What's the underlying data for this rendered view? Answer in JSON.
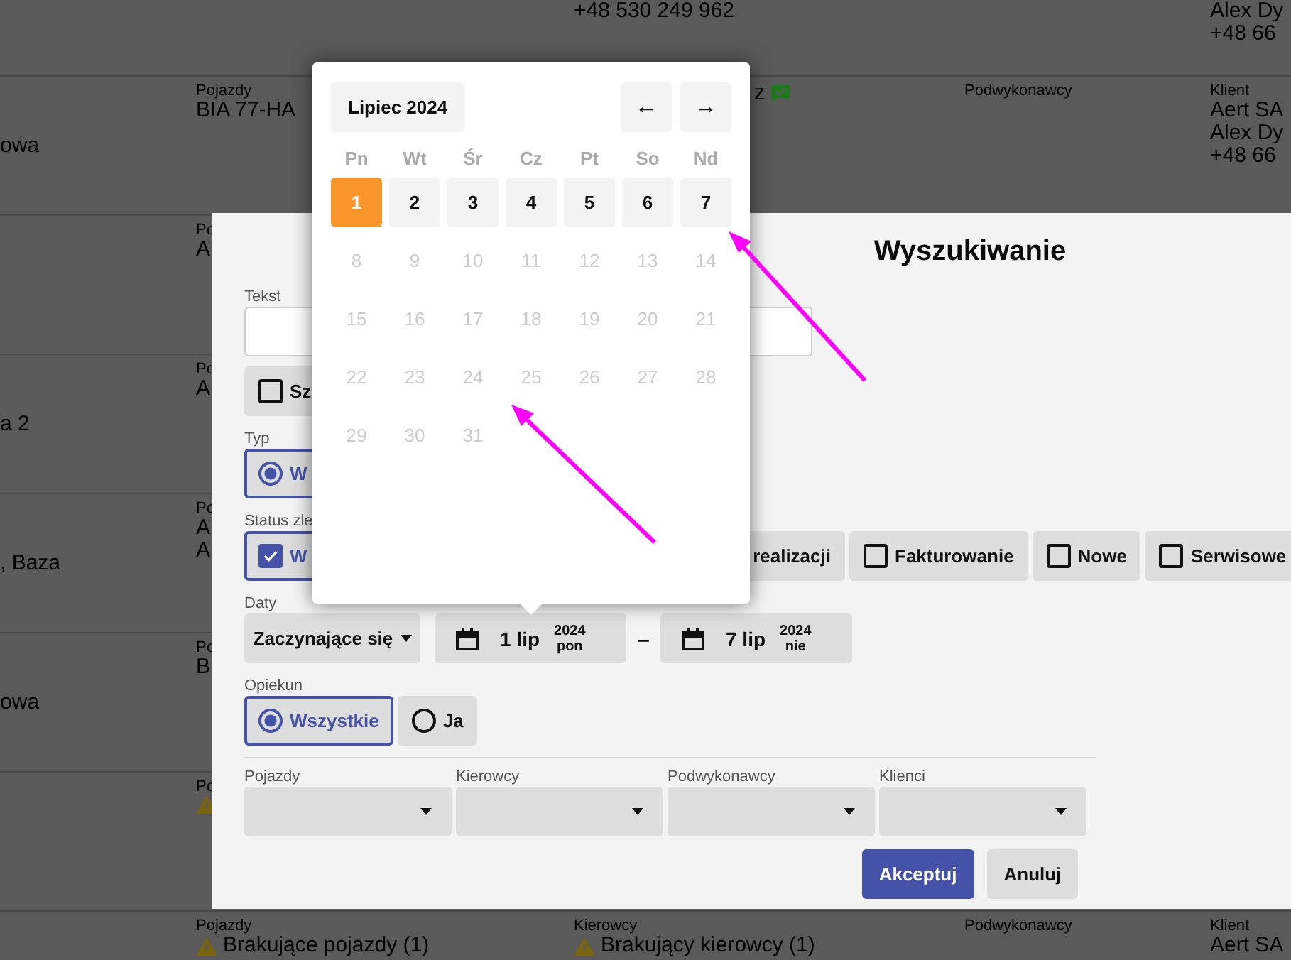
{
  "orders": [
    {
      "cells": [
        {
          "kind": "drivers",
          "warning": false,
          "message_sent": false,
          "lines": [
            "+48 530 249 962"
          ]
        },
        {
          "kind": "client",
          "warning": false,
          "message_sent": false,
          "lines": [
            "Alex Dy",
            "+48 66"
          ]
        }
      ]
    },
    {
      "text": "owa",
      "cells": [
        {
          "kind": "vehicles",
          "warning": false,
          "message_sent": false,
          "label": "Pojazdy",
          "lines": [
            "BIA 77-HA"
          ]
        },
        {
          "kind": "drivers",
          "warning": false,
          "message_sent": true,
          "lines": [
            "z"
          ]
        },
        {
          "kind": "subcontractors",
          "warning": false,
          "message_sent": false,
          "label": "Podwykonawcy"
        },
        {
          "kind": "client",
          "warning": false,
          "message_sent": false,
          "label": "Klient",
          "lines": [
            "Aert SA",
            "Alex Dy",
            "+48 66"
          ]
        }
      ]
    },
    {
      "cells": [
        {
          "kind": "vehicles",
          "warning": false,
          "label": "Po",
          "lines": [
            "A"
          ]
        }
      ]
    },
    {
      "text": "a 2",
      "cells": [
        {
          "kind": "vehicles",
          "warning": false,
          "label": "Po",
          "lines": [
            "A"
          ]
        }
      ]
    },
    {
      "text": ", Baza",
      "cells": [
        {
          "kind": "vehicles",
          "warning": false,
          "label": "Po",
          "lines": [
            "A",
            "A"
          ]
        }
      ]
    },
    {
      "text": "owa",
      "cells": [
        {
          "kind": "vehicles",
          "warning": false,
          "label": "Po",
          "lines": [
            "B"
          ]
        }
      ]
    },
    {
      "cells": [
        {
          "kind": "vehicles",
          "warning": true,
          "label": "Po"
        }
      ]
    },
    {
      "cells": [
        {
          "kind": "vehicles",
          "warning": true,
          "message_sent": false,
          "label": "Pojazdy",
          "lines": [
            "Brakujące pojazdy (1)"
          ]
        },
        {
          "kind": "drivers",
          "warning": true,
          "message_sent": false,
          "label": "Kierowcy",
          "lines": [
            "Brakujący kierowcy (1)"
          ]
        },
        {
          "kind": "subcontractors",
          "warning": false,
          "message_sent": false,
          "label": "Podwykonawcy"
        },
        {
          "kind": "client",
          "warning": false,
          "message_sent": false,
          "label": "Klient",
          "lines": [
            "Aert SA"
          ]
        }
      ]
    }
  ],
  "search_dialog": {
    "title": "Wyszukiwanie",
    "text_field": {
      "label": "Tekst"
    },
    "toggle": {
      "label": "Sz",
      "checked": false
    },
    "type": {
      "label": "Typ",
      "options": [
        {
          "label": "W",
          "selected": true
        }
      ]
    },
    "status": {
      "label": "Status zle",
      "options": [
        {
          "label": "W",
          "checked": true
        },
        {
          "label": "realizacji"
        },
        {
          "label": "Fakturowanie",
          "checked": false
        },
        {
          "label": "Nowe",
          "checked": false
        },
        {
          "label": "Serwisowe",
          "checked": false
        }
      ]
    },
    "dates": {
      "label": "Daty",
      "mode": "Zaczynające się",
      "from": {
        "day": "1 lip",
        "year": "2024",
        "weekday": "pon"
      },
      "separator": "–",
      "to": {
        "day": "7 lip",
        "year": "2024",
        "weekday": "nie"
      }
    },
    "owner": {
      "label": "Opiekun",
      "options": [
        {
          "label": "Wszystkie",
          "selected": true
        },
        {
          "label": "Ja",
          "selected": false
        }
      ]
    },
    "filters": [
      {
        "label": "Pojazdy"
      },
      {
        "label": "Kierowcy"
      },
      {
        "label": "Podwykonawcy"
      },
      {
        "label": "Klienci"
      }
    ],
    "buttons": [
      {
        "label": "Akceptuj",
        "kind": "primary"
      },
      {
        "label": "Anuluj",
        "kind": "secondary"
      }
    ]
  },
  "calendar": {
    "month": "Lipiec 2024",
    "prev": "←",
    "next": "→",
    "weekdays": [
      "Pn",
      "Wt",
      "Śr",
      "Cz",
      "Pt",
      "So",
      "Nd"
    ],
    "days": [
      {
        "label": "1",
        "selected": true,
        "disabled": false
      },
      {
        "label": "2",
        "selected": false,
        "disabled": false
      },
      {
        "label": "3",
        "selected": false,
        "disabled": false
      },
      {
        "label": "4",
        "selected": false,
        "disabled": false
      },
      {
        "label": "5",
        "selected": false,
        "disabled": false
      },
      {
        "label": "6",
        "selected": false,
        "disabled": false
      },
      {
        "label": "7",
        "selected": false,
        "disabled": false
      },
      {
        "label": "8",
        "selected": false,
        "disabled": true
      },
      {
        "label": "9",
        "selected": false,
        "disabled": true
      },
      {
        "label": "10",
        "selected": false,
        "disabled": true
      },
      {
        "label": "11",
        "selected": false,
        "disabled": true
      },
      {
        "label": "12",
        "selected": false,
        "disabled": true
      },
      {
        "label": "13",
        "selected": false,
        "disabled": true
      },
      {
        "label": "14",
        "selected": false,
        "disabled": true
      },
      {
        "label": "15",
        "selected": false,
        "disabled": true
      },
      {
        "label": "16",
        "selected": false,
        "disabled": true
      },
      {
        "label": "17",
        "selected": false,
        "disabled": true
      },
      {
        "label": "18",
        "selected": false,
        "disabled": true
      },
      {
        "label": "19",
        "selected": false,
        "disabled": true
      },
      {
        "label": "20",
        "selected": false,
        "disabled": true
      },
      {
        "label": "21",
        "selected": false,
        "disabled": true
      },
      {
        "label": "22",
        "selected": false,
        "disabled": true
      },
      {
        "label": "23",
        "selected": false,
        "disabled": true
      },
      {
        "label": "24",
        "selected": false,
        "disabled": true
      },
      {
        "label": "25",
        "selected": false,
        "disabled": true
      },
      {
        "label": "26",
        "selected": false,
        "disabled": true
      },
      {
        "label": "27",
        "selected": false,
        "disabled": true
      },
      {
        "label": "28",
        "selected": false,
        "disabled": true
      },
      {
        "label": "29",
        "selected": false,
        "disabled": true
      },
      {
        "label": "30",
        "selected": false,
        "disabled": true
      },
      {
        "label": "31",
        "selected": false,
        "disabled": true
      }
    ]
  }
}
